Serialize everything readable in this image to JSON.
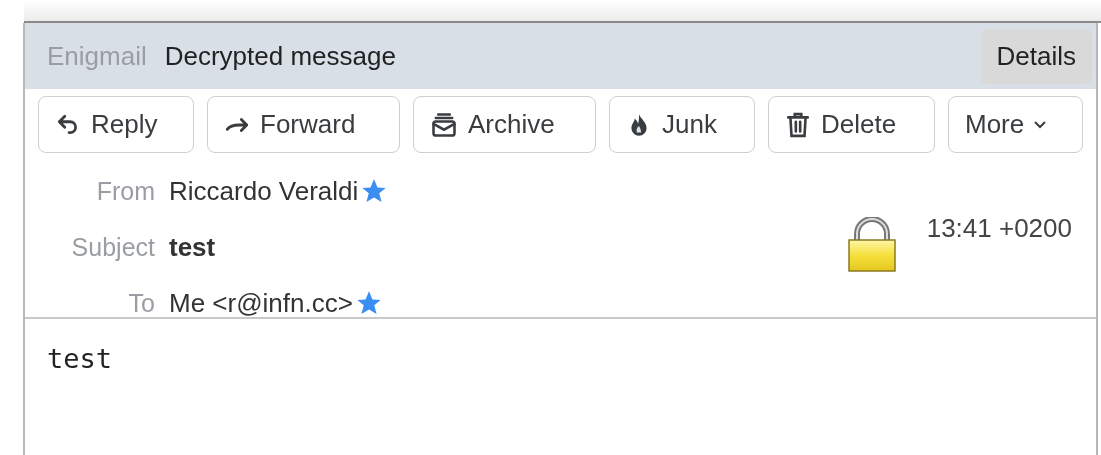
{
  "security_bar": {
    "source": "Enigmail",
    "status": "Decrypted message",
    "details_button": "Details"
  },
  "toolbar": [
    {
      "kind": "reply",
      "label": "Reply"
    },
    {
      "kind": "forward",
      "label": "Forward"
    },
    {
      "kind": "archive",
      "label": "Archive"
    },
    {
      "kind": "junk",
      "label": "Junk"
    },
    {
      "kind": "delete",
      "label": "Delete"
    },
    {
      "kind": "more",
      "label": "More"
    }
  ],
  "headers": [
    {
      "label": "From",
      "value": "Riccardo Veraldi",
      "bold": false,
      "starred": true
    },
    {
      "label": "Subject",
      "value": "test",
      "bold": true,
      "starred": false
    },
    {
      "label": "To",
      "value": "Me <r@infn.cc>",
      "bold": false,
      "starred": true
    }
  ],
  "date": "13:41 +0200",
  "encrypted": true,
  "body": "test"
}
